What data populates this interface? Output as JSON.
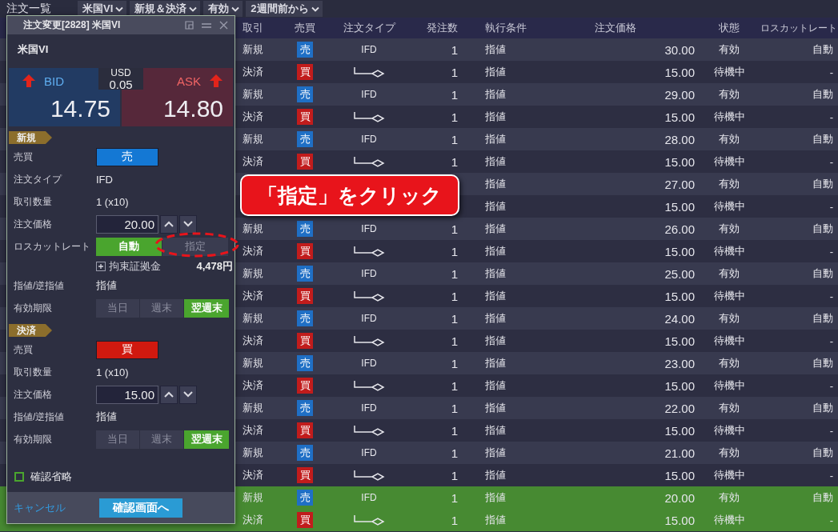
{
  "top_bar": {
    "title": "注文一覧",
    "filters": [
      {
        "label": "米国VI"
      },
      {
        "label": "新規＆決済"
      },
      {
        "label": "有効"
      },
      {
        "label": "2週間前から"
      }
    ]
  },
  "order_dialog": {
    "title": "注文変更[2828] 米国VI",
    "symbol": "米国VI",
    "quote": {
      "bid_label": "BID",
      "bid": "14.75",
      "ask_label": "ASK",
      "ask": "14.80",
      "spread_unit": "USD",
      "spread": "0.05"
    },
    "sections": [
      {
        "tag": "新規",
        "fields": [
          {
            "kind": "side",
            "label": "売買",
            "button": {
              "label": "売",
              "kind": "sell"
            }
          },
          {
            "kind": "text",
            "label": "注文タイプ",
            "value": "IFD"
          },
          {
            "kind": "text",
            "label": "取引数量",
            "value": "1 (x10)"
          },
          {
            "kind": "price",
            "label": "注文価格",
            "value": "20.00"
          },
          {
            "kind": "segment",
            "label": "ロスカットレート",
            "options": [
              {
                "label": "自動",
                "selected": true
              },
              {
                "label": "指定",
                "selected": false
              }
            ]
          },
          {
            "kind": "margin",
            "label": "拘束証拠金",
            "value": "4,478円",
            "expanded": false
          },
          {
            "kind": "text",
            "label": "指値/逆指値",
            "value": "指値"
          },
          {
            "kind": "segment",
            "label": "有効期限",
            "options": [
              {
                "label": "当日",
                "selected": false
              },
              {
                "label": "週末",
                "selected": false
              },
              {
                "label": "翌週末",
                "selected": true
              }
            ]
          }
        ]
      },
      {
        "tag": "決済",
        "fields": [
          {
            "kind": "side",
            "label": "売買",
            "button": {
              "label": "買",
              "kind": "buy"
            }
          },
          {
            "kind": "text",
            "label": "取引数量",
            "value": "1 (x10)"
          },
          {
            "kind": "price",
            "label": "注文価格",
            "value": "15.00"
          },
          {
            "kind": "text",
            "label": "指値/逆指値",
            "value": "指値"
          },
          {
            "kind": "segment",
            "label": "有効期限",
            "options": [
              {
                "label": "当日",
                "selected": false
              },
              {
                "label": "週末",
                "selected": false
              },
              {
                "label": "翌週末",
                "selected": true
              }
            ]
          }
        ]
      }
    ],
    "skip_confirm": {
      "label": "確認省略",
      "checked": false
    },
    "cancel": "キャンセル",
    "confirm": "確認画面へ"
  },
  "callout": {
    "text": "「指定」をクリック"
  },
  "orders": {
    "columns": [
      "取引",
      "売買",
      "注文タイプ",
      "発注数",
      "執行条件",
      "注文価格",
      "状態",
      "ロスカットレート"
    ],
    "rows": [
      {
        "trade": "新規",
        "side": {
          "label": "売",
          "kind": "sell"
        },
        "type": {
          "kind": "text",
          "text": "IFD"
        },
        "qty": "1",
        "condition": "指値",
        "price": "30.00",
        "status": "有効",
        "losscut": "自動",
        "selected": false
      },
      {
        "trade": "決済",
        "side": {
          "label": "買",
          "kind": "buy"
        },
        "type": {
          "kind": "icon"
        },
        "qty": "1",
        "condition": "指値",
        "price": "15.00",
        "status": "待機中",
        "losscut": "-",
        "selected": false
      },
      {
        "trade": "新規",
        "side": {
          "label": "売",
          "kind": "sell"
        },
        "type": {
          "kind": "text",
          "text": "IFD"
        },
        "qty": "1",
        "condition": "指値",
        "price": "29.00",
        "status": "有効",
        "losscut": "自動",
        "selected": false
      },
      {
        "trade": "決済",
        "side": {
          "label": "買",
          "kind": "buy"
        },
        "type": {
          "kind": "icon"
        },
        "qty": "1",
        "condition": "指値",
        "price": "15.00",
        "status": "待機中",
        "losscut": "-",
        "selected": false
      },
      {
        "trade": "新規",
        "side": {
          "label": "売",
          "kind": "sell"
        },
        "type": {
          "kind": "text",
          "text": "IFD"
        },
        "qty": "1",
        "condition": "指値",
        "price": "28.00",
        "status": "有効",
        "losscut": "自動",
        "selected": false
      },
      {
        "trade": "決済",
        "side": {
          "label": "買",
          "kind": "buy"
        },
        "type": {
          "kind": "icon"
        },
        "qty": "1",
        "condition": "指値",
        "price": "15.00",
        "status": "待機中",
        "losscut": "-",
        "selected": false
      },
      {
        "condition": "指値",
        "price": "27.00",
        "status": "有効",
        "losscut": "自動",
        "selected": false
      },
      {
        "condition": "指値",
        "price": "15.00",
        "status": "待機中",
        "losscut": "-",
        "selected": false
      },
      {
        "trade": "新規",
        "side": {
          "label": "売",
          "kind": "sell"
        },
        "type": {
          "kind": "text",
          "text": "IFD"
        },
        "qty": "1",
        "condition": "指値",
        "price": "26.00",
        "status": "有効",
        "losscut": "自動",
        "selected": false
      },
      {
        "trade": "決済",
        "side": {
          "label": "買",
          "kind": "buy"
        },
        "type": {
          "kind": "icon"
        },
        "qty": "1",
        "condition": "指値",
        "price": "15.00",
        "status": "待機中",
        "losscut": "-",
        "selected": false
      },
      {
        "trade": "新規",
        "side": {
          "label": "売",
          "kind": "sell"
        },
        "type": {
          "kind": "text",
          "text": "IFD"
        },
        "qty": "1",
        "condition": "指値",
        "price": "25.00",
        "status": "有効",
        "losscut": "自動",
        "selected": false
      },
      {
        "trade": "決済",
        "side": {
          "label": "買",
          "kind": "buy"
        },
        "type": {
          "kind": "icon"
        },
        "qty": "1",
        "condition": "指値",
        "price": "15.00",
        "status": "待機中",
        "losscut": "-",
        "selected": false
      },
      {
        "trade": "新規",
        "side": {
          "label": "売",
          "kind": "sell"
        },
        "type": {
          "kind": "text",
          "text": "IFD"
        },
        "qty": "1",
        "condition": "指値",
        "price": "24.00",
        "status": "有効",
        "losscut": "自動",
        "selected": false
      },
      {
        "trade": "決済",
        "side": {
          "label": "買",
          "kind": "buy"
        },
        "type": {
          "kind": "icon"
        },
        "qty": "1",
        "condition": "指値",
        "price": "15.00",
        "status": "待機中",
        "losscut": "-",
        "selected": false
      },
      {
        "trade": "新規",
        "side": {
          "label": "売",
          "kind": "sell"
        },
        "type": {
          "kind": "text",
          "text": "IFD"
        },
        "qty": "1",
        "condition": "指値",
        "price": "23.00",
        "status": "有効",
        "losscut": "自動",
        "selected": false
      },
      {
        "trade": "決済",
        "side": {
          "label": "買",
          "kind": "buy"
        },
        "type": {
          "kind": "icon"
        },
        "qty": "1",
        "condition": "指値",
        "price": "15.00",
        "status": "待機中",
        "losscut": "-",
        "selected": false
      },
      {
        "trade": "新規",
        "side": {
          "label": "売",
          "kind": "sell"
        },
        "type": {
          "kind": "text",
          "text": "IFD"
        },
        "qty": "1",
        "condition": "指値",
        "price": "22.00",
        "status": "有効",
        "losscut": "自動",
        "selected": false
      },
      {
        "trade": "決済",
        "side": {
          "label": "買",
          "kind": "buy"
        },
        "type": {
          "kind": "icon"
        },
        "qty": "1",
        "condition": "指値",
        "price": "15.00",
        "status": "待機中",
        "losscut": "-",
        "selected": false
      },
      {
        "trade": "新規",
        "side": {
          "label": "売",
          "kind": "sell"
        },
        "type": {
          "kind": "text",
          "text": "IFD"
        },
        "qty": "1",
        "condition": "指値",
        "price": "21.00",
        "status": "有効",
        "losscut": "自動",
        "selected": false
      },
      {
        "trade": "決済",
        "side": {
          "label": "買",
          "kind": "buy"
        },
        "type": {
          "kind": "icon"
        },
        "qty": "1",
        "condition": "指値",
        "price": "15.00",
        "status": "待機中",
        "losscut": "-",
        "selected": false
      },
      {
        "trade": "新規",
        "side": {
          "label": "売",
          "kind": "sell"
        },
        "type": {
          "kind": "text",
          "text": "IFD"
        },
        "qty": "1",
        "condition": "指値",
        "price": "20.00",
        "status": "有効",
        "losscut": "自動",
        "selected": true
      },
      {
        "trade": "決済",
        "side": {
          "label": "買",
          "kind": "buy"
        },
        "type": {
          "kind": "icon"
        },
        "qty": "1",
        "condition": "指値",
        "price": "15.00",
        "status": "待機中",
        "losscut": "-",
        "selected": true
      }
    ]
  }
}
